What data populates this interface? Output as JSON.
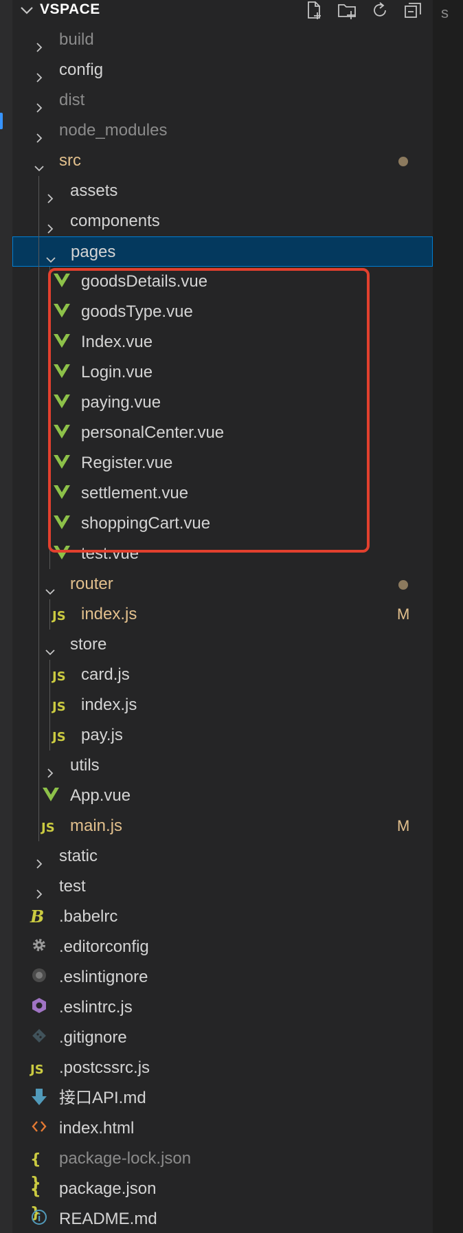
{
  "explorer": {
    "title": "VSPACE",
    "actions": [
      {
        "name": "new-file-icon"
      },
      {
        "name": "new-folder-icon"
      },
      {
        "name": "refresh-icon"
      },
      {
        "name": "collapse-all-icon"
      }
    ]
  },
  "editor_edge_text": "s",
  "colors": {
    "background": "#252526",
    "selected_row": "#04395e",
    "selected_border": "#007fd4",
    "modified": "#e2c08d",
    "vue_green": "#8dc149",
    "js_yellow": "#cbcb41",
    "annotation_red": "#e2402e"
  },
  "tree": [
    {
      "label": "build",
      "type": "folder",
      "expanded": false,
      "depth": 0,
      "dim": true
    },
    {
      "label": "config",
      "type": "folder",
      "expanded": false,
      "depth": 0
    },
    {
      "label": "dist",
      "type": "folder",
      "expanded": false,
      "depth": 0,
      "dim": true
    },
    {
      "label": "node_modules",
      "type": "folder",
      "expanded": false,
      "depth": 0,
      "dim": true
    },
    {
      "label": "src",
      "type": "folder",
      "expanded": true,
      "depth": 0,
      "modified": true,
      "dot": true
    },
    {
      "label": "assets",
      "type": "folder",
      "expanded": false,
      "depth": 1
    },
    {
      "label": "components",
      "type": "folder",
      "expanded": false,
      "depth": 1
    },
    {
      "label": "pages",
      "type": "folder",
      "expanded": true,
      "depth": 1,
      "selected": true
    },
    {
      "label": "goodsDetails.vue",
      "type": "vue",
      "depth": 2
    },
    {
      "label": "goodsType.vue",
      "type": "vue",
      "depth": 2
    },
    {
      "label": "Index.vue",
      "type": "vue",
      "depth": 2
    },
    {
      "label": "Login.vue",
      "type": "vue",
      "depth": 2
    },
    {
      "label": "paying.vue",
      "type": "vue",
      "depth": 2
    },
    {
      "label": "personalCenter.vue",
      "type": "vue",
      "depth": 2
    },
    {
      "label": "Register.vue",
      "type": "vue",
      "depth": 2
    },
    {
      "label": "settlement.vue",
      "type": "vue",
      "depth": 2
    },
    {
      "label": "shoppingCart.vue",
      "type": "vue",
      "depth": 2
    },
    {
      "label": "test.vue",
      "type": "vue",
      "depth": 2
    },
    {
      "label": "router",
      "type": "folder",
      "expanded": true,
      "depth": 1,
      "modified": true,
      "dot": true
    },
    {
      "label": "index.js",
      "type": "js",
      "depth": 2,
      "modified": true,
      "badge": "M"
    },
    {
      "label": "store",
      "type": "folder",
      "expanded": true,
      "depth": 1
    },
    {
      "label": "card.js",
      "type": "js",
      "depth": 2
    },
    {
      "label": "index.js",
      "type": "js",
      "depth": 2
    },
    {
      "label": "pay.js",
      "type": "js",
      "depth": 2
    },
    {
      "label": "utils",
      "type": "folder",
      "expanded": false,
      "depth": 1
    },
    {
      "label": "App.vue",
      "type": "vue",
      "depth": 1
    },
    {
      "label": "main.js",
      "type": "js",
      "depth": 1,
      "modified": true,
      "badge": "M"
    },
    {
      "label": "static",
      "type": "folder",
      "expanded": false,
      "depth": 0
    },
    {
      "label": "test",
      "type": "folder",
      "expanded": false,
      "depth": 0
    },
    {
      "label": ".babelrc",
      "type": "babel",
      "depth": 0
    },
    {
      "label": ".editorconfig",
      "type": "gear",
      "depth": 0
    },
    {
      "label": ".eslintignore",
      "type": "eslintignore",
      "depth": 0
    },
    {
      "label": ".eslintrc.js",
      "type": "eslint",
      "depth": 0
    },
    {
      "label": ".gitignore",
      "type": "git",
      "depth": 0
    },
    {
      "label": ".postcssrc.js",
      "type": "js",
      "depth": 0
    },
    {
      "label": "接口API.md",
      "type": "markdown-down",
      "depth": 0
    },
    {
      "label": "index.html",
      "type": "html",
      "depth": 0
    },
    {
      "label": "package-lock.json",
      "type": "json",
      "depth": 0,
      "dim": true
    },
    {
      "label": "package.json",
      "type": "json",
      "depth": 0
    },
    {
      "label": "README.md",
      "type": "info",
      "depth": 0
    }
  ]
}
